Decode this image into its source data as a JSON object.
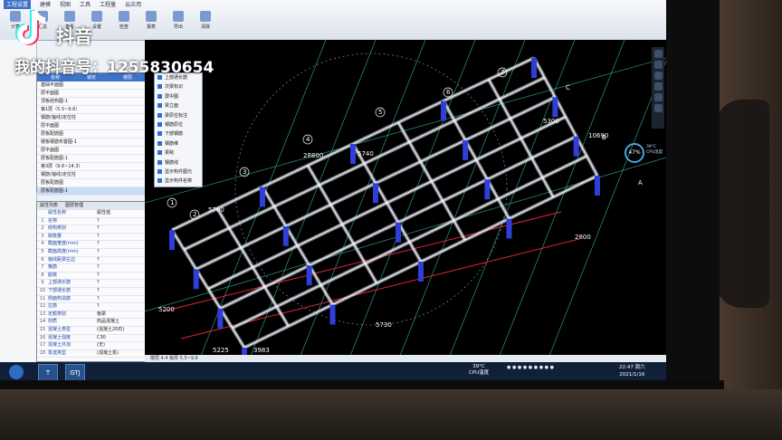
{
  "ribbon": {
    "tabs": [
      "工程设置",
      "建模",
      "视图",
      "工具",
      "工程量",
      "云应用"
    ],
    "buttons": [
      "计算",
      "汇总",
      "查看",
      "设置",
      "检查",
      "报表",
      "导出",
      "清除"
    ]
  },
  "layer_panel": {
    "headers": [
      "名称",
      "锁定",
      "楼层"
    ],
    "rows": [
      "基础平面图",
      "层平面图",
      "顶板结构图-1",
      "第1层（5.5~9.6）",
      "钢筋(轴线)定位柱",
      "层平面图",
      "层板配筋图",
      "楼板钢筋布置图-1",
      "层平面图",
      "层板配筋图-1",
      "第3层（9.6~14.3）",
      "钢筋(轴线)定位柱",
      "层板配筋图",
      "层板配筋图-1"
    ]
  },
  "prop_panel": {
    "tabs": [
      "属性列表",
      "图层管理"
    ],
    "col_name": "属性名称",
    "col_value": "属性值",
    "rows": [
      {
        "n": "1",
        "k": "名称",
        "v": "?"
      },
      {
        "n": "2",
        "k": "结构类别",
        "v": "?"
      },
      {
        "n": "3",
        "k": "跨数量",
        "v": "?"
      },
      {
        "n": "4",
        "k": "截面宽度(mm)",
        "v": "?"
      },
      {
        "n": "5",
        "k": "截面高度(mm)",
        "v": "?"
      },
      {
        "n": "6",
        "k": "轴线距梁左边",
        "v": "?"
      },
      {
        "n": "7",
        "k": "箍筋",
        "v": "?"
      },
      {
        "n": "8",
        "k": "胶数",
        "v": "?"
      },
      {
        "n": "9",
        "k": "上部通长筋",
        "v": "?"
      },
      {
        "n": "10",
        "k": "下部通长筋",
        "v": "?"
      },
      {
        "n": "11",
        "k": "侧面构造筋",
        "v": "?"
      },
      {
        "n": "12",
        "k": "拉筋",
        "v": "?"
      },
      {
        "n": "13",
        "k": "定额类别",
        "v": "板梁"
      },
      {
        "n": "14",
        "k": "材质",
        "v": "商品混凝土"
      },
      {
        "n": "15",
        "k": "混凝土类型",
        "v": "(混凝土20石)"
      },
      {
        "n": "16",
        "k": "混凝土强度",
        "v": "C30"
      },
      {
        "n": "17",
        "k": "混凝土外加",
        "v": "(无)"
      },
      {
        "n": "18",
        "k": "泵送类型",
        "v": "(混凝土泵)"
      }
    ]
  },
  "layer_check": [
    "上部通长筋",
    "次梁标识",
    "屏中图",
    "梁立面",
    "梁原位标注",
    "钢筋原位",
    "下部钢筋",
    "钢筋维",
    "梁跨",
    "钢筋线",
    "显示构件图元",
    "显示构件名称"
  ],
  "cad": {
    "dims": [
      "28800",
      "5740",
      "5730",
      "2800",
      "5700",
      "5300",
      "10690",
      "5200",
      "5225",
      "3983"
    ],
    "axis_numbers": [
      "1",
      "2",
      "3",
      "4",
      "5",
      "6",
      "7"
    ],
    "axis_letters": [
      "A",
      "B",
      "C"
    ]
  },
  "status_bar": "楼层 4.4   板厚 5.5~9.6",
  "cpu": {
    "percent": "47%",
    "temp": "39°C",
    "label": "CPU温度"
  },
  "taskbar": {
    "apps": [
      "T",
      "GTJ"
    ],
    "temp_line1": "39°C",
    "temp_line2": "CPU温度",
    "time": "22:47 周六",
    "date": "2021/1/16"
  },
  "watermark": {
    "title": "抖音",
    "id": "我的抖音号：1255830654"
  },
  "colors": {
    "viewport_bg": "#000000",
    "beam": "#e8ecff",
    "column": "#2f3ed8",
    "dim_line": "#3fe0a6",
    "axis_red": "#e4243a",
    "accent": "#3e74c8"
  }
}
